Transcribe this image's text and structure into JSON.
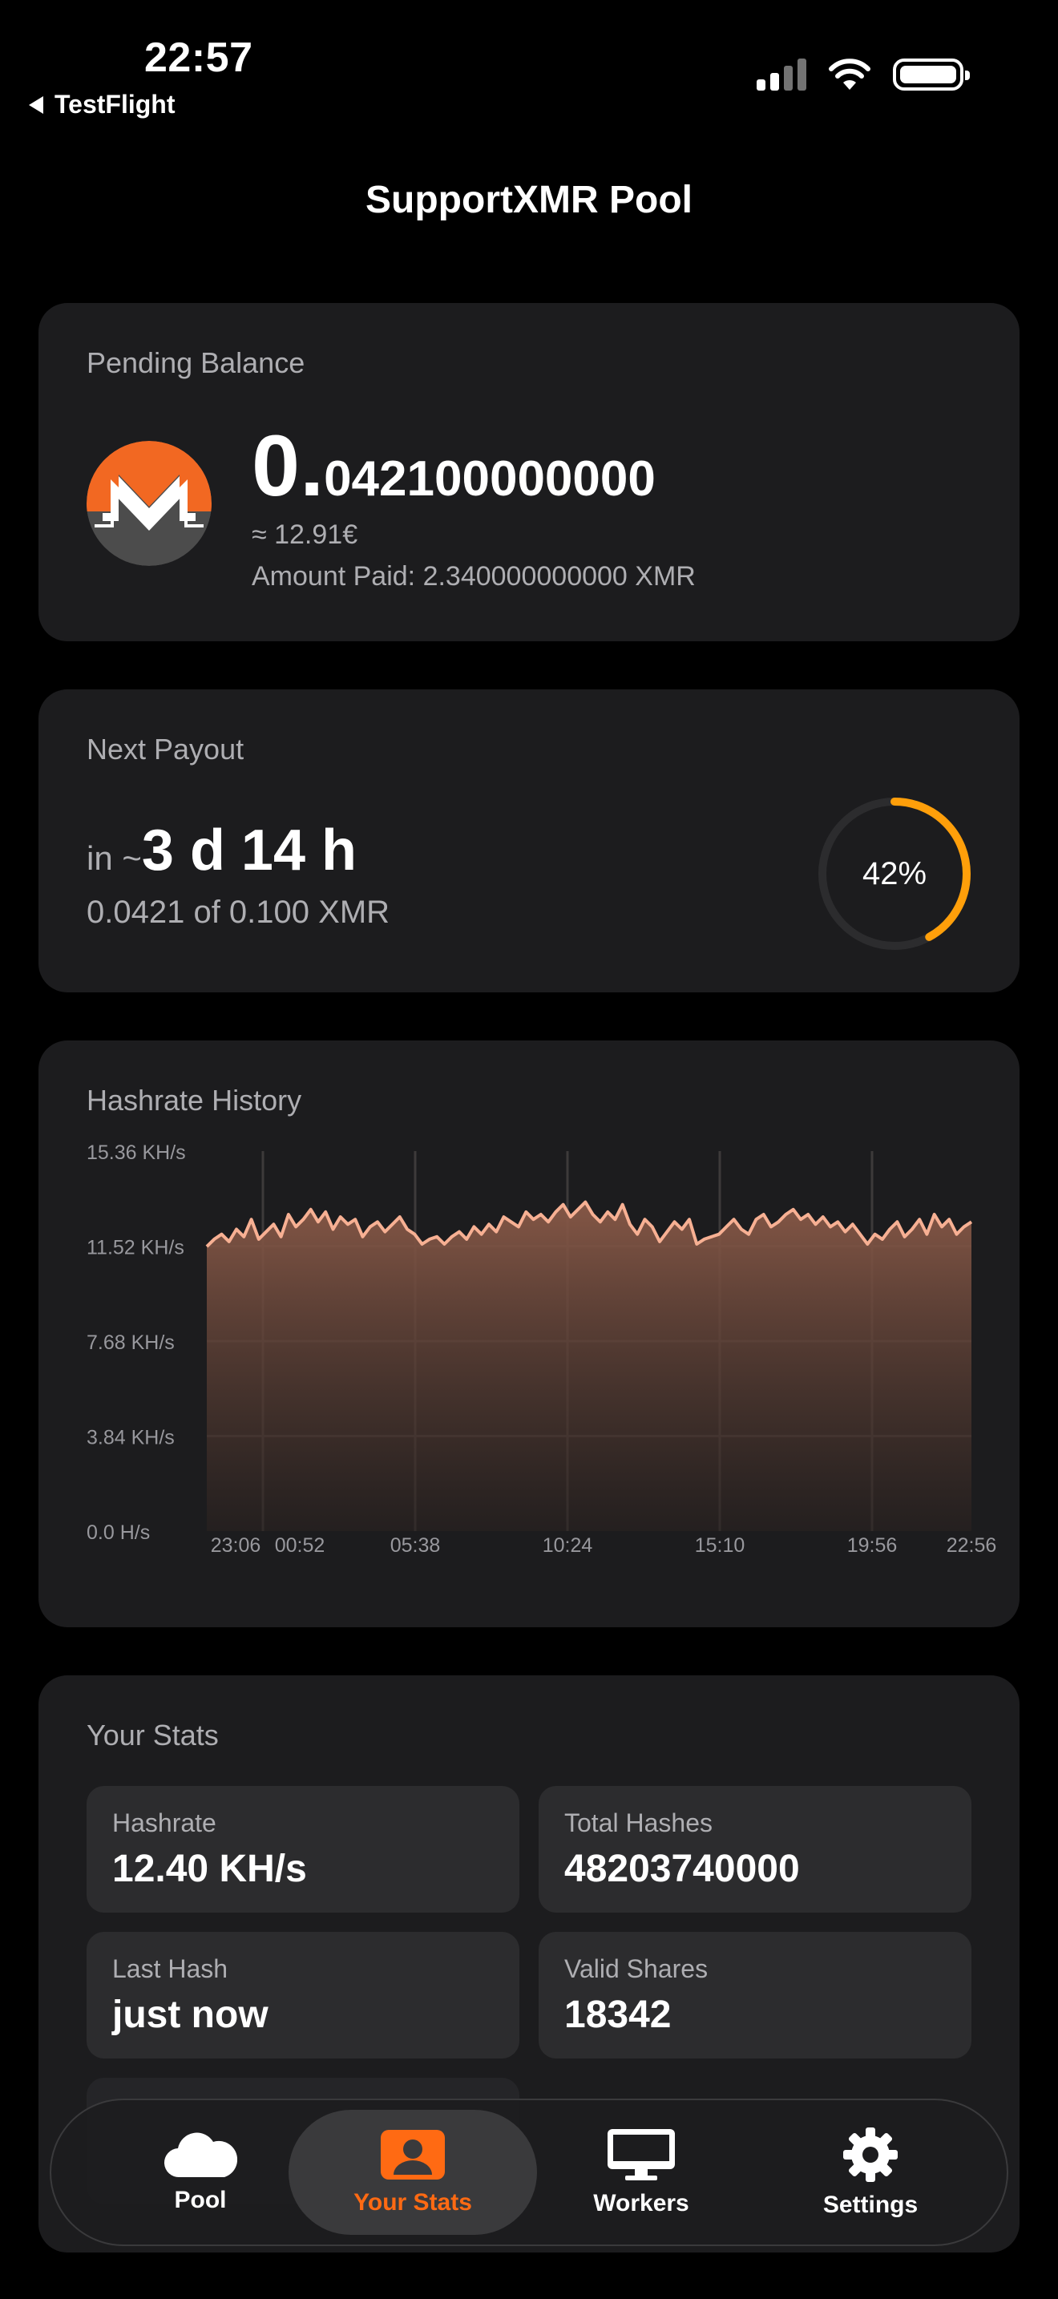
{
  "status_bar": {
    "time": "22:57",
    "back_label": "TestFlight"
  },
  "nav": {
    "title": "SupportXMR Pool"
  },
  "balance": {
    "title": "Pending Balance",
    "amount_int": "0.",
    "amount_dec": "042100000000",
    "fiat": "≈ 12.91€",
    "paid": "Amount Paid: 2.340000000000 XMR",
    "logo_colors": {
      "orange": "#f26822",
      "gray": "#4c4c4c"
    }
  },
  "payout": {
    "title": "Next Payout",
    "prefix": "in ~",
    "eta": "3 d 14 h",
    "progress_text": "0.0421 of 0.100 XMR",
    "percent_label": "42%",
    "percent": 42,
    "accent": "#ff9f0a"
  },
  "hashrate": {
    "title": "Hashrate History",
    "line_color": "#f7b093"
  },
  "chart_data": {
    "type": "area",
    "title": "Hashrate History",
    "y_ticks": [
      "15.36 KH/s",
      "11.52 KH/s",
      "7.68 KH/s",
      "3.84 KH/s",
      "0.0 H/s"
    ],
    "y_tick_values": [
      15.36,
      11.52,
      7.68,
      3.84,
      0
    ],
    "ylim": [
      0,
      15.36
    ],
    "x_ticks": [
      "23:06",
      "00:52",
      "05:38",
      "10:24",
      "15:10",
      "19:56",
      "22:56"
    ],
    "series": [
      {
        "values": [
          11.5,
          11.8,
          12.0,
          11.7,
          12.2,
          11.9,
          12.6,
          11.8,
          12.1,
          12.4,
          11.9,
          12.8,
          12.3,
          12.6,
          13.0,
          12.5,
          12.9,
          12.2,
          12.7,
          12.4,
          12.6,
          11.9,
          12.3,
          12.5,
          12.1,
          12.4,
          12.7,
          12.2,
          12.0,
          11.6,
          11.8,
          11.9,
          11.6,
          11.9,
          12.1,
          11.8,
          12.3,
          12.0,
          12.4,
          12.1,
          12.7,
          12.5,
          12.3,
          12.9,
          12.6,
          12.8,
          12.5,
          12.9,
          13.2,
          12.7,
          13.0,
          13.3,
          12.8,
          12.5,
          12.9,
          12.6,
          13.2,
          12.4,
          12.0,
          12.6,
          12.3,
          11.7,
          12.1,
          12.5,
          12.2,
          12.6,
          11.6,
          11.8,
          11.9,
          12.0,
          12.3,
          12.6,
          12.2,
          12.0,
          12.6,
          12.8,
          12.3,
          12.5,
          12.8,
          13.0,
          12.6,
          12.8,
          12.4,
          12.7,
          12.3,
          12.5,
          12.1,
          12.4,
          12.0,
          11.6,
          12.0,
          11.8,
          12.2,
          12.5,
          11.9,
          12.2,
          12.6,
          12.0,
          12.8,
          12.3,
          12.6,
          12.0,
          12.3,
          12.5
        ]
      }
    ]
  },
  "stats": {
    "title": "Your Stats",
    "tiles": [
      {
        "label": "Hashrate",
        "value": "12.40 KH/s"
      },
      {
        "label": "Total Hashes",
        "value": "48203740000"
      },
      {
        "label": "Last Hash",
        "value": "just now"
      },
      {
        "label": "Valid Shares",
        "value": "18342"
      }
    ]
  },
  "tabbar": {
    "accent": "#ff6a13",
    "tabs": [
      {
        "label": "Pool",
        "icon": "cloud-icon"
      },
      {
        "label": "Your Stats",
        "icon": "person-icon"
      },
      {
        "label": "Workers",
        "icon": "desktop-icon"
      },
      {
        "label": "Settings",
        "icon": "gear-icon"
      }
    ]
  }
}
